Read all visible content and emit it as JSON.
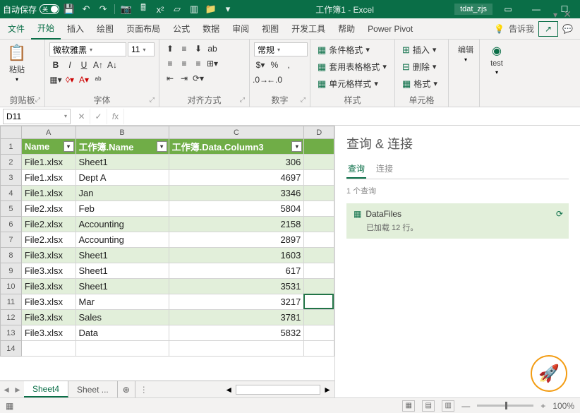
{
  "titlebar": {
    "autosave": "自动保存",
    "toggle": "关",
    "title": "工作簿1 - Excel",
    "user": "tdat_zjs"
  },
  "menu": {
    "file": "文件",
    "home": "开始",
    "insert": "插入",
    "draw": "绘图",
    "layout": "页面布局",
    "formula": "公式",
    "data": "数据",
    "review": "审阅",
    "view": "视图",
    "dev": "开发工具",
    "help": "帮助",
    "pivot": "Power Pivot",
    "tell": "告诉我"
  },
  "ribbon": {
    "clipboard": {
      "paste": "粘贴",
      "label": "剪贴板"
    },
    "font": {
      "name": "微软雅黑",
      "size": "11",
      "label": "字体"
    },
    "align": {
      "wrap": "ab",
      "label": "对齐方式"
    },
    "number": {
      "fmt": "常规",
      "label": "数字"
    },
    "style": {
      "cond": "条件格式",
      "table": "套用表格格式",
      "cell": "单元格样式",
      "label": "样式"
    },
    "cells": {
      "insert": "插入",
      "delete": "删除",
      "format": "格式",
      "label": "单元格"
    },
    "edit": {
      "label": "编辑"
    },
    "test": {
      "label": "test"
    }
  },
  "namebox": "D11",
  "columns": [
    "A",
    "B",
    "C",
    "D"
  ],
  "headers": [
    "Name",
    "工作簿.Name",
    "工作簿.Data.Column3"
  ],
  "rows": [
    {
      "a": "File1.xlsx",
      "b": "Sheet1",
      "c": 306
    },
    {
      "a": "File1.xlsx",
      "b": "Dept A",
      "c": 4697
    },
    {
      "a": "File1.xlsx",
      "b": "Jan",
      "c": 3346
    },
    {
      "a": "File2.xlsx",
      "b": "Feb",
      "c": 5804
    },
    {
      "a": "File2.xlsx",
      "b": "Accounting",
      "c": 2158
    },
    {
      "a": "File2.xlsx",
      "b": "Accounting",
      "c": 2897
    },
    {
      "a": "File3.xlsx",
      "b": "Sheet1",
      "c": 1603
    },
    {
      "a": "File3.xlsx",
      "b": "Sheet1",
      "c": 617
    },
    {
      "a": "File3.xlsx",
      "b": "Sheet1",
      "c": 3531
    },
    {
      "a": "File3.xlsx",
      "b": "Mar",
      "c": 3217
    },
    {
      "a": "File3.xlsx",
      "b": "Sales",
      "c": 3781
    },
    {
      "a": "File3.xlsx",
      "b": "Data",
      "c": 5832
    }
  ],
  "tabs": {
    "active": "Sheet4",
    "other": "Sheet ..."
  },
  "pane": {
    "title": "查询 & 连接",
    "tab1": "查询",
    "tab2": "连接",
    "count": "1 个查询",
    "query": "DataFiles",
    "loaded": "已加载 12 行。"
  },
  "status": {
    "zoom": "100%"
  }
}
